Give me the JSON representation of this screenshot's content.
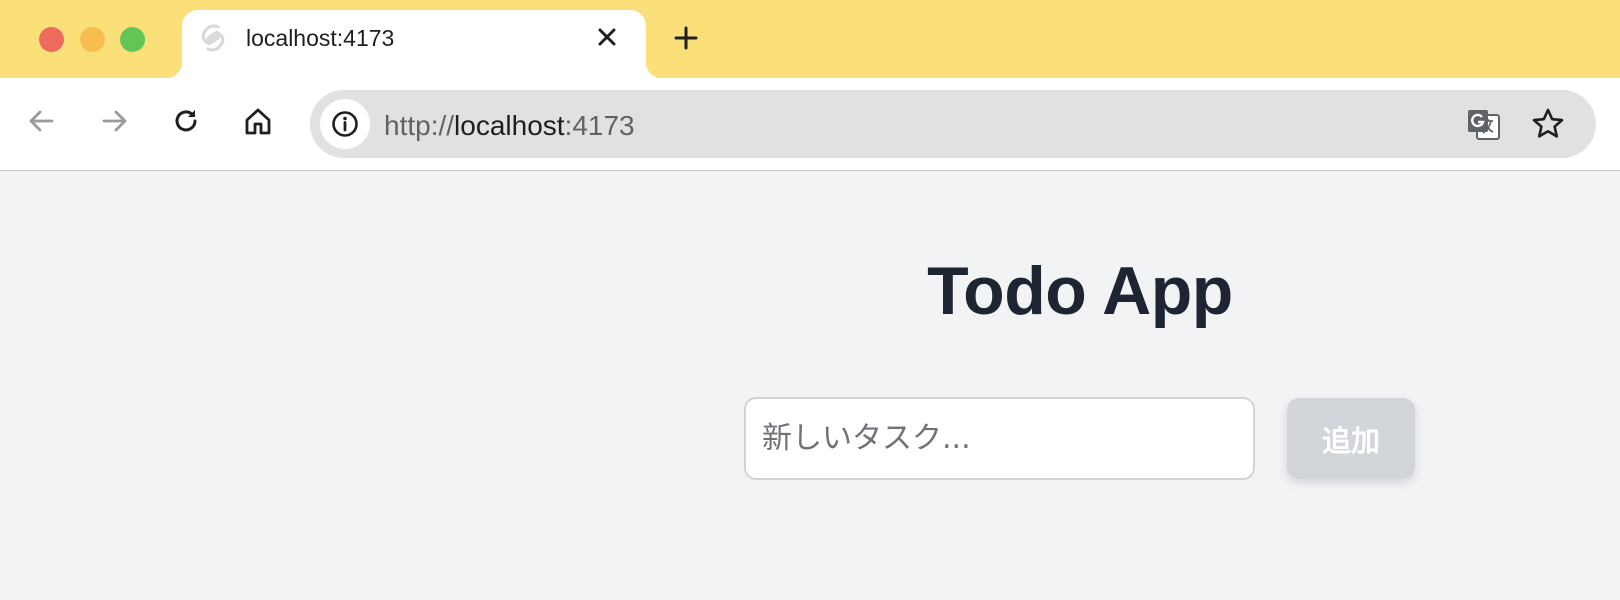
{
  "browser": {
    "tab": {
      "title": "localhost:4173",
      "favicon": "svelte-icon"
    },
    "address_bar": {
      "scheme": "http://",
      "host": "localhost",
      "port": ":4173"
    },
    "colors": {
      "tab_strip": "#fbe07a",
      "traffic_close": "#ee6a5f",
      "traffic_minimize": "#f5be4f",
      "traffic_maximize": "#62c554"
    }
  },
  "app": {
    "title": "Todo App",
    "task_input": {
      "value": "",
      "placeholder": "新しいタスク..."
    },
    "add_button_label": "追加",
    "colors": {
      "heading": "#1d2533",
      "button_disabled": "#d2d5da",
      "background": "#f2f3f5"
    }
  }
}
